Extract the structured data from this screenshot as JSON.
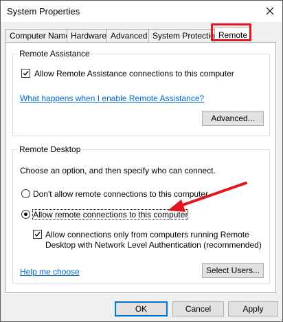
{
  "window": {
    "title": "System Properties",
    "close_icon": "close-icon"
  },
  "tabs": [
    {
      "label": "Computer Name"
    },
    {
      "label": "Hardware"
    },
    {
      "label": "Advanced"
    },
    {
      "label": "System Protection"
    },
    {
      "label": "Remote"
    }
  ],
  "remote_assistance": {
    "legend": "Remote Assistance",
    "checkbox_label": "Allow Remote Assistance connections to this computer",
    "checked": true,
    "link": "What happens when I enable Remote Assistance?",
    "advanced_button": "Advanced..."
  },
  "remote_desktop": {
    "legend": "Remote Desktop",
    "intro": "Choose an option, and then specify who can connect.",
    "option_dont": "Don't allow remote connections to this computer",
    "option_allow": "Allow remote connections to this computer",
    "selected_option": "allow",
    "nla_line1": "Allow connections only from computers running Remote",
    "nla_line2": "Desktop with Network Level Authentication (recommended)",
    "nla_checked": true,
    "help_link": "Help me choose",
    "select_users_button": "Select Users..."
  },
  "footer": {
    "ok": "OK",
    "cancel": "Cancel",
    "apply": "Apply"
  },
  "colors": {
    "highlight": "#e3151d",
    "link": "#0066cc",
    "accent": "#0078d7"
  }
}
